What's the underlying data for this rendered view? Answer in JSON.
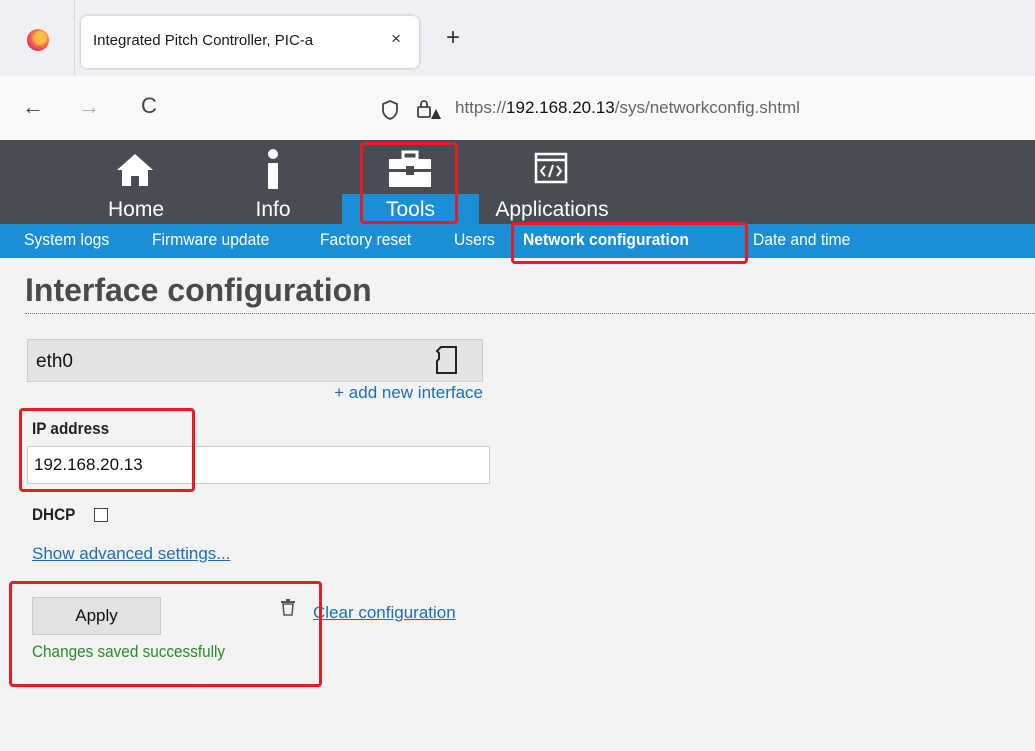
{
  "browser": {
    "tab_title": "Integrated Pitch Controller, PIC-a",
    "tab_close": "×",
    "new_tab": "+",
    "back": "←",
    "forward": "→",
    "reload": "C",
    "url_prefix": "https://",
    "url_host": "192.168.20.13",
    "url_path": "/sys/networkconfig.shtml"
  },
  "main_nav": [
    {
      "label": "Home",
      "icon": "home-icon"
    },
    {
      "label": "Info",
      "icon": "info-icon"
    },
    {
      "label": "Tools",
      "icon": "toolbox-icon",
      "active": true
    },
    {
      "label": "Applications",
      "icon": "code-icon"
    }
  ],
  "sub_nav": [
    {
      "label": "System logs"
    },
    {
      "label": "Firmware update"
    },
    {
      "label": "Factory reset"
    },
    {
      "label": "Users"
    },
    {
      "label": "Network configuration",
      "active": true
    },
    {
      "label": "Date and time"
    }
  ],
  "page": {
    "title": "Interface configuration",
    "interface_name": "eth0",
    "add_interface": "+ add new interface",
    "ip_label": "IP address",
    "ip_value": "192.168.20.13",
    "dhcp_label": "DHCP",
    "dhcp_checked": false,
    "advanced_link": "Show advanced settings...",
    "apply_label": "Apply",
    "clear_label": "Clear configuration",
    "status_message": "Changes saved successfully"
  },
  "colors": {
    "header_bg": "#474d53",
    "accent_blue": "#1a8fd8",
    "link": "#1a6fb8",
    "success": "#2a8a2a",
    "highlight": "#e41e1e"
  }
}
